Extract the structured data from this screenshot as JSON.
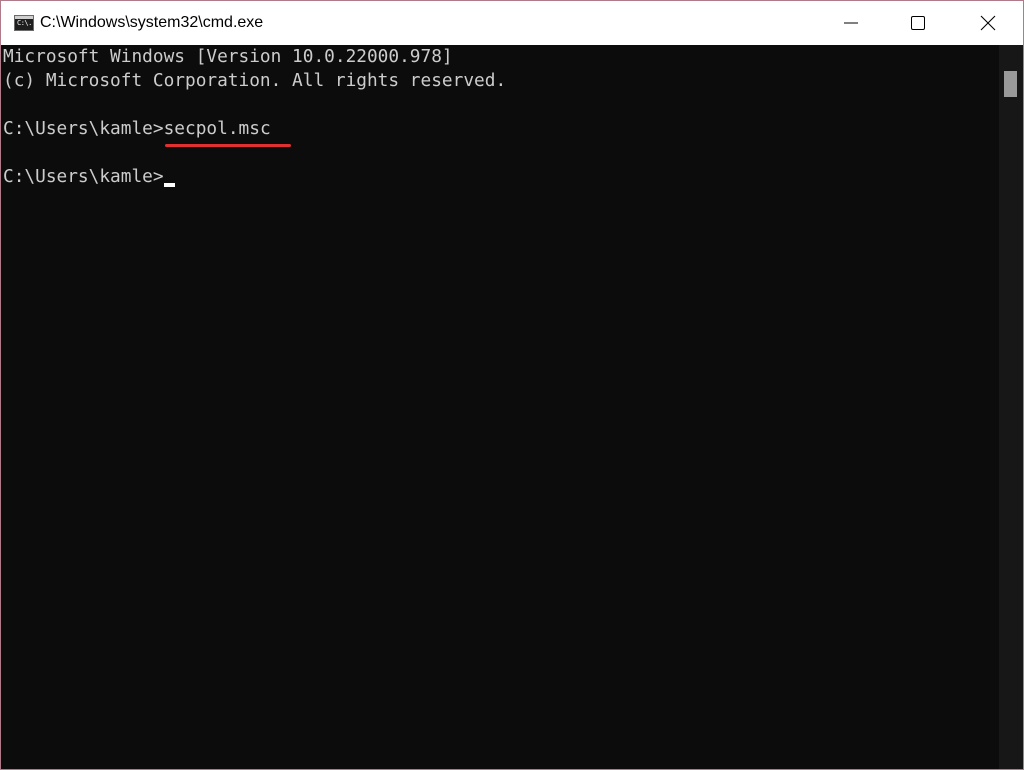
{
  "window": {
    "title": "C:\\Windows\\system32\\cmd.exe",
    "icon_glyph": "C:\\.",
    "border_color": "#b07a8a"
  },
  "controls": {
    "minimize": "minimize-icon",
    "maximize": "maximize-icon",
    "close": "close-icon"
  },
  "console": {
    "lines": [
      "Microsoft Windows [Version 10.0.22000.978]",
      "(c) Microsoft Corporation. All rights reserved."
    ],
    "prompt1": "C:\\Users\\kamle>",
    "command1": "secpol.msc",
    "prompt2": "C:\\Users\\kamle>",
    "text_color": "#cccccc",
    "background": "#0c0c0c",
    "highlight_color": "#e03030"
  }
}
